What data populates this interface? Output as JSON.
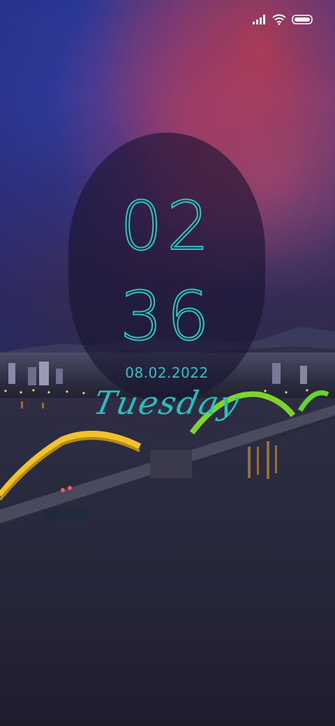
{
  "status_bar": {
    "signal_icon": "signal-bars-icon",
    "wifi_icon": "wifi-icon",
    "battery_icon": "battery-icon"
  },
  "lockscreen": {
    "hours": "02",
    "minutes": "36",
    "date": "08.02.2022",
    "weekday": "Tuesday"
  },
  "colors": {
    "clock_accent": "#2cc7c0"
  }
}
